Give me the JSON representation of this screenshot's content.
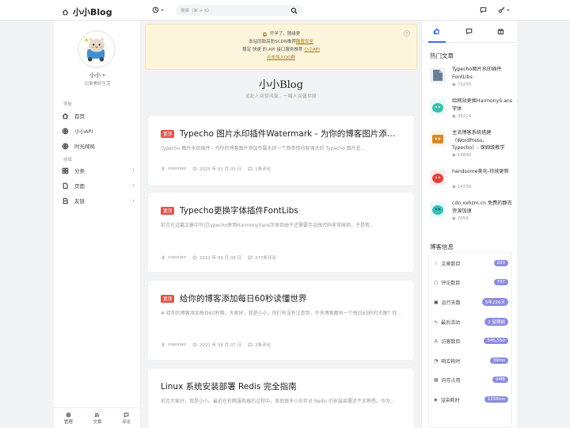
{
  "header": {
    "site_name": "小小Blog",
    "search_placeholder": "搜索（⌘ + K）"
  },
  "sidebar": {
    "user_name": "小小",
    "user_desc": "记录美好生活",
    "section_nav": "导航",
    "section_components": "组成",
    "nav": [
      {
        "label": "首页",
        "icon": "home-icon"
      },
      {
        "label": "小小API",
        "icon": "globe-icon"
      },
      {
        "label": "时光邮局",
        "icon": "globe-icon"
      }
    ],
    "components": [
      {
        "label": "分类",
        "icon": "grid-icon"
      },
      {
        "label": "页面",
        "icon": "page-icon"
      },
      {
        "label": "友链",
        "icon": "link-icon"
      }
    ],
    "bottom": [
      {
        "label": "管理",
        "icon": "gear-icon"
      },
      {
        "label": "文章",
        "icon": "rss-icon"
      },
      {
        "label": "评论",
        "icon": "comment-icon"
      }
    ]
  },
  "notice": {
    "line1": "开学了，随缘更",
    "line2_prefix": "本站同款高防SCDN推荐",
    "line2_link": "酷盾安全",
    "line3_prefix": "稳定 快速 的 API 接口服务推荐",
    "line3_link": "小小API",
    "line4_link": "点击加入QQ群"
  },
  "site": {
    "title": "小小Blog",
    "subtitle": "远赴人间惊鸿宴，一睹人间盛世颜"
  },
  "posts": [
    {
      "pinned": true,
      "pin_label": "置顶",
      "title": "Typecho 图片水印插件Watermark - 为你的博客图片添加水印",
      "excerpt": "Typecho 图片水印插件 - 为你的博客图片添加专属水印一个简单但功能强大的 Typecho 图片处...",
      "author": "xiaoxiao",
      "date": "2025 年 01 月 05 日",
      "comments": "1条评论"
    },
    {
      "pinned": true,
      "pin_label": "置顶",
      "title": "Typecho更换字体插件FontLibs",
      "excerpt": "前言在这篇文章中写过typecho使用HarmonySans字体但由于还需要手动改代码非常麻烦，于是我...",
      "author": "xiaoxiao",
      "date": "2022 年 09 月 06 日",
      "comments": "277条评论"
    },
    {
      "pinned": true,
      "pin_label": "置顶",
      "title": "给你的博客添加每日60秒读懂世界",
      "excerpt": "# 给你的博客添加每日60秒哦，大家好，我是小小。你们有没有注意到，许多博客都有一个每日60秒的大图？你...",
      "author": "xiaoxiao",
      "date": "2021 年 08 月 07 日",
      "comments": "2条评论"
    },
    {
      "pinned": false,
      "pin_label": "",
      "title": "Linux 系统安装部署 Redis 完全指南",
      "excerpt": "前言大家好，我是小小。最近在折腾服务器的过程中，发现很多小伙伴对 Redis 的安装部署还不太熟悉。作为...",
      "author": "",
      "date": "",
      "comments": ""
    }
  ],
  "right": {
    "hot_title": "热门文章",
    "hot": [
      {
        "title": "Typecho图片水印插件FontLibs",
        "views": "73255",
        "color": "#6a7f96"
      },
      {
        "title": "给网站更换HarmonyS ans字体",
        "views": "35214",
        "color": "#3cbfae"
      },
      {
        "title": "主流博客系统搭建（WordPress、Typecho）- 保姆级教学",
        "views": "18890",
        "color": "#d9892b"
      },
      {
        "title": "handsome美化-持续更新",
        "views": "14730",
        "color": "#e0433a"
      },
      {
        "title": "cdn.xxhzm.cn 免费的静态资源加速",
        "views": "7059",
        "color": "#31bfb5"
      }
    ],
    "info_title": "博客信息",
    "stats": [
      {
        "label": "文章数目",
        "value": "203",
        "color": "#8c8ce0",
        "icon": "bulb-icon"
      },
      {
        "label": "评论数目",
        "value": "797",
        "color": "#8c8ce0",
        "icon": "comment-icon"
      },
      {
        "label": "运行天数",
        "value": "5年226天",
        "color": "#8c8ce0",
        "icon": "calendar-icon"
      },
      {
        "label": "最后活动",
        "value": "2 星期前",
        "color": "#8c8ce0",
        "icon": "activity-icon"
      },
      {
        "label": "访客数目",
        "value": "546,550",
        "color": "#8c8ce0",
        "icon": "visitor-icon"
      },
      {
        "label": "响应耗时",
        "value": "39ms",
        "color": "#8c8ce0",
        "icon": "clock-icon"
      },
      {
        "label": "内存占用",
        "value": "9MB",
        "color": "#8c8ce0",
        "icon": "memory-icon"
      },
      {
        "label": "渲染耗时",
        "value": "1258ms",
        "color": "#8c8ce0",
        "icon": "render-icon"
      }
    ]
  }
}
